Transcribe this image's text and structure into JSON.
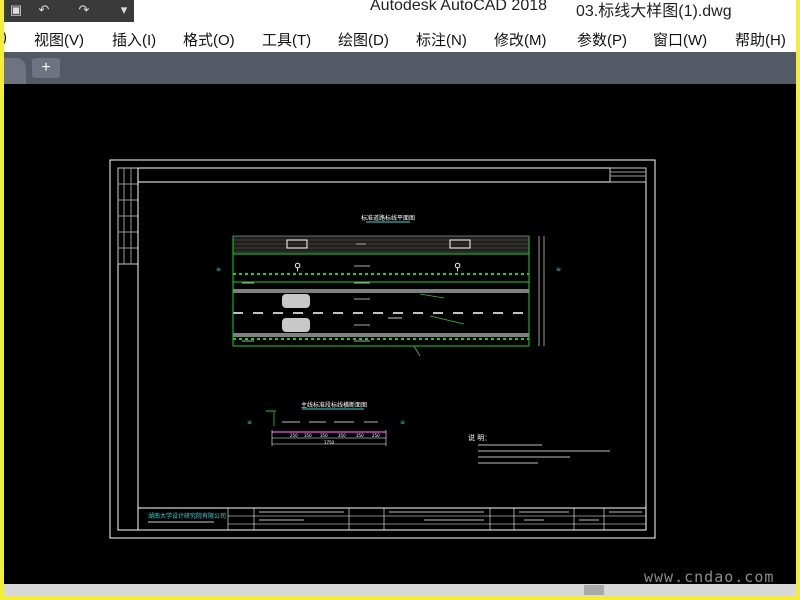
{
  "window": {
    "app_title": "Autodesk AutoCAD 2018",
    "file_name": "03.标线大样图(1).dwg"
  },
  "menu": {
    "items": [
      {
        "label": ")"
      },
      {
        "label": "视图(V)"
      },
      {
        "label": "插入(I)"
      },
      {
        "label": "格式(O)"
      },
      {
        "label": "工具(T)"
      },
      {
        "label": "绘图(D)"
      },
      {
        "label": "标注(N)"
      },
      {
        "label": "修改(M)"
      },
      {
        "label": "参数(P)"
      },
      {
        "label": "窗口(W)"
      },
      {
        "label": "帮助(H)"
      }
    ]
  },
  "tabs": {
    "add_label": "+"
  },
  "drawing": {
    "plan_title": "标准道路标线平面图",
    "section_title": "主线标准段标线横断面图",
    "notes_title": "说 明：",
    "company": "湖南大学设计研究院有限公司",
    "total_width": "1750",
    "dims": [
      "250",
      "350",
      "350",
      "350",
      "350",
      "250"
    ]
  },
  "watermark": "www.cndao.com",
  "colors": {
    "background": "#000000",
    "frame": "#f3ee3a",
    "cad_white": "#ffffff",
    "cad_green": "#1fd11f",
    "cad_cyan": "#38d7d7",
    "cad_magenta": "#d33cd3"
  },
  "icons": {
    "quick_access": [
      "save-icon",
      "undo-icon",
      "redo-icon",
      "dropdown-icon"
    ],
    "add_tab": "plus-icon"
  }
}
